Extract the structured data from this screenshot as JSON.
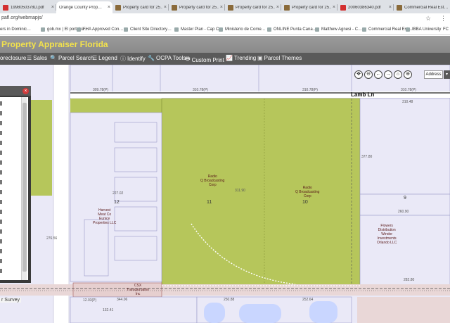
{
  "browser": {
    "tabs": [
      {
        "label": "1998050378D.pdf",
        "icon": "pdf",
        "active": false
      },
      {
        "label": "Orange County Prop…",
        "icon": "map",
        "active": true
      },
      {
        "label": "Property card for 25…",
        "icon": "card",
        "active": false
      },
      {
        "label": "Property card for 25…",
        "icon": "card",
        "active": false
      },
      {
        "label": "Property card for 25…",
        "icon": "card",
        "active": false
      },
      {
        "label": "Property card for 25…",
        "icon": "card",
        "active": false
      },
      {
        "label": "20060386340.pdf",
        "icon": "pdf",
        "active": false
      },
      {
        "label": "Commercial Real Est…",
        "icon": "card",
        "active": false
      }
    ],
    "close_glyph": "×",
    "url": "pafl.org/webmapjs/",
    "star_glyph": "☆",
    "menu_glyph": "⋮",
    "bookmarks": [
      "ers in Dominic…",
      "gob.mx | El portal ú…",
      "FHA Approved Con…",
      "Client Site Directory…",
      "Master Plan - Cap C…",
      "Ministerio de Come…",
      "ONLINE Punta Cana…",
      "Matthew Agnesi - C…",
      "Commercial Real Est…",
      "IBBA University",
      "FC"
    ]
  },
  "app": {
    "title": "Property Appraiser Florida",
    "colors": {
      "title": "#f3e24c",
      "parcel_highlight": "#b6c65b",
      "map_bg": "#eae9f7"
    }
  },
  "toolbar": [
    {
      "label": "oreclosure",
      "icon": ""
    },
    {
      "label": "Sales",
      "icon": "☰"
    },
    {
      "label": "Parcel Search",
      "icon": "🔍"
    },
    {
      "label": "Legend",
      "icon": "☰"
    },
    {
      "label": "Identify",
      "icon": "ⓘ"
    },
    {
      "label": "OCPA Tools",
      "icon": "🔧"
    },
    {
      "label": "Custom Print",
      "icon": "🖶"
    },
    {
      "label": "Trending",
      "icon": "📈"
    },
    {
      "label": "Parcel Themes",
      "icon": "▣"
    }
  ],
  "map": {
    "street": "Lamb Ln",
    "nav_buttons": [
      "✥",
      "⊖",
      "←",
      "→",
      "⌂",
      "⊕",
      "✕"
    ],
    "address_button": "Address",
    "address_dropdown": "▾",
    "panel_close": "×",
    "survey_chip": "r Survey",
    "dimensions": [
      "309.78(P)",
      "310.78(P)",
      "310.78(P)",
      "310.78(P)",
      "310.48",
      "377.80",
      "260.90",
      "282.80",
      "344.06",
      "250.88",
      "252.64",
      "132.41",
      "276.56",
      "227.02",
      "311.90",
      "12.03(P)"
    ],
    "lots": [
      {
        "number": "12",
        "owner": "Harvest\nMeat Co\nEunice\nProperties LLC"
      },
      {
        "number": "11",
        "owner": "Radio\nQ Broadcasting\nCorp"
      },
      {
        "number": "10",
        "owner": "Radio\nQ Broadcasting\nCorp"
      },
      {
        "number": "9",
        "owner": ""
      },
      {
        "number": "",
        "owner": "Flowers\nDistribution\nWindor\nInvestments\nOrlando LLC"
      },
      {
        "number": "",
        "owner": "CSX\nTransportation\nInc"
      }
    ]
  }
}
